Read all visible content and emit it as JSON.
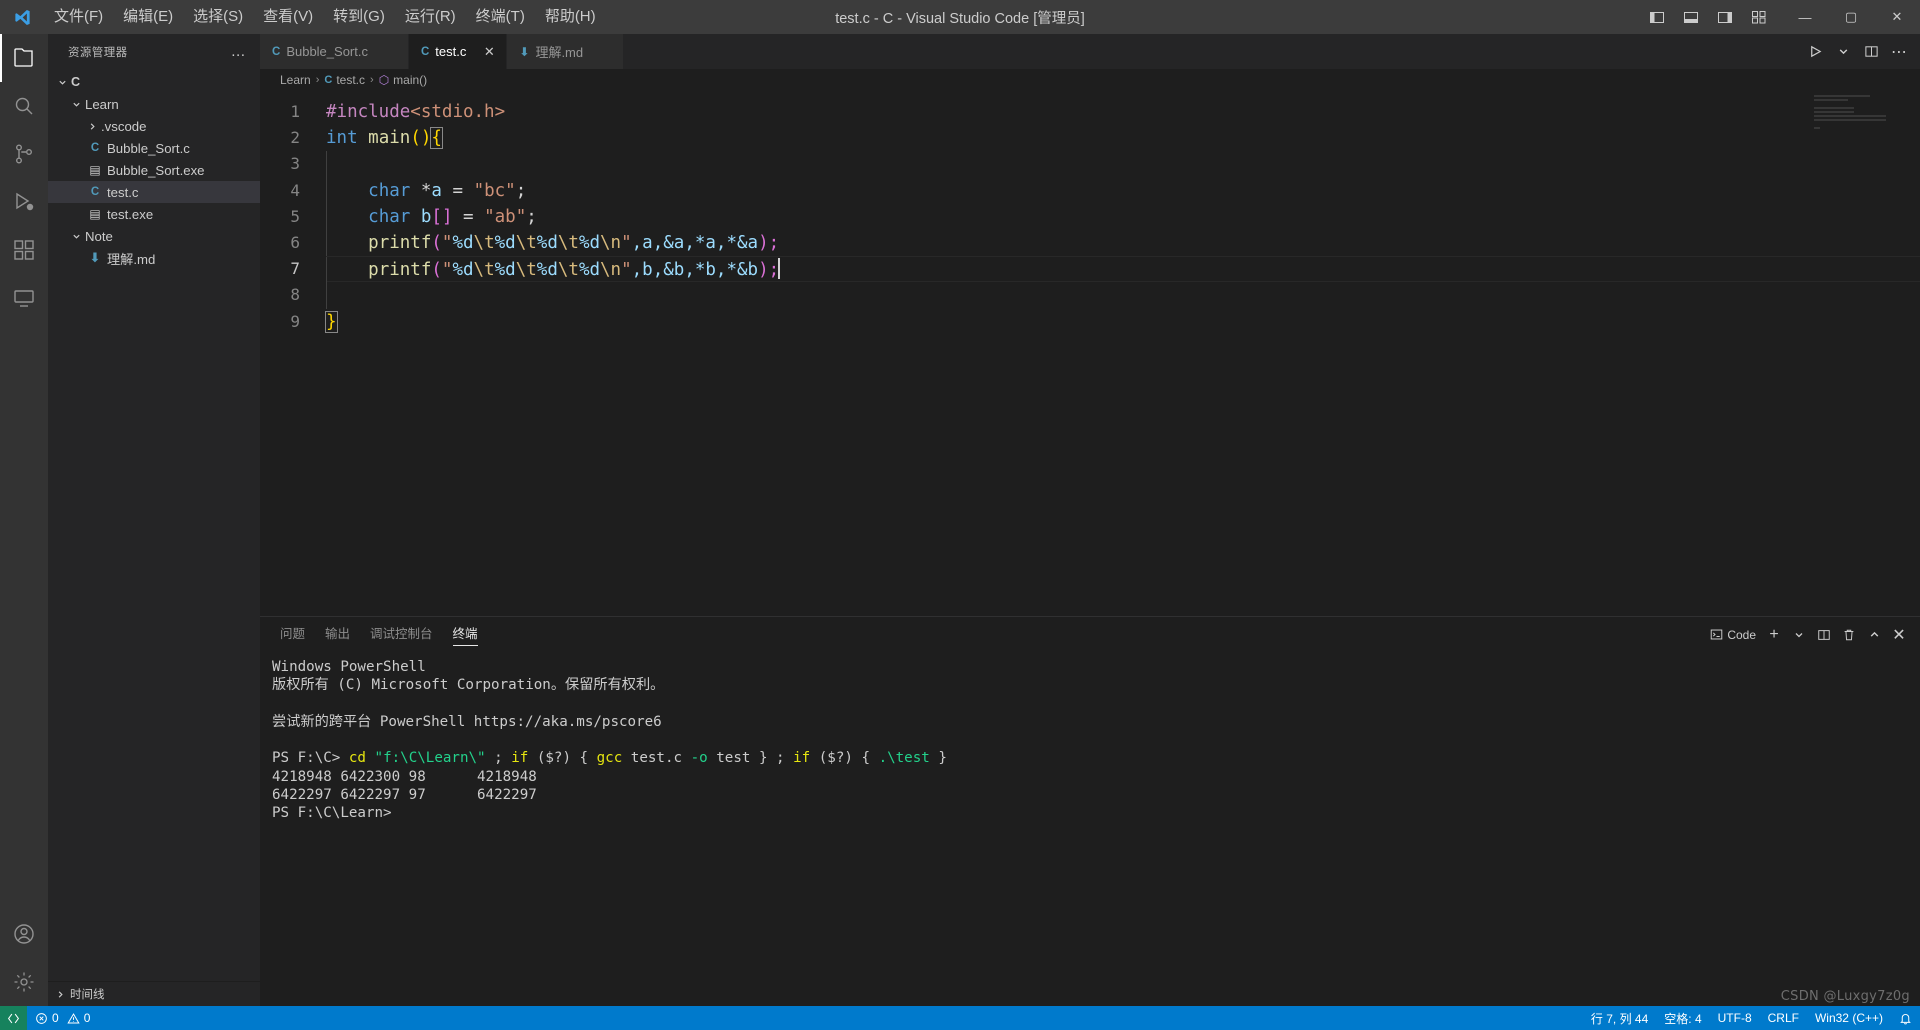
{
  "window": {
    "title": "test.c - C - Visual Studio Code [管理员]",
    "logo_icon": "vscode-logo",
    "minimize_label": "—",
    "maximize_label": "▢",
    "close_label": "✕"
  },
  "menu": {
    "items": [
      {
        "label": "文件(F)",
        "name": "menu-file"
      },
      {
        "label": "编辑(E)",
        "name": "menu-edit"
      },
      {
        "label": "选择(S)",
        "name": "menu-selection"
      },
      {
        "label": "查看(V)",
        "name": "menu-view"
      },
      {
        "label": "转到(G)",
        "name": "menu-goto"
      },
      {
        "label": "运行(R)",
        "name": "menu-run"
      },
      {
        "label": "终端(T)",
        "name": "menu-terminal"
      },
      {
        "label": "帮助(H)",
        "name": "menu-help"
      }
    ]
  },
  "activitybar": {
    "items": [
      {
        "icon": "files-icon",
        "name": "activity-explorer",
        "active": true
      },
      {
        "icon": "search-icon",
        "name": "activity-search",
        "active": false
      },
      {
        "icon": "source-control-icon",
        "name": "activity-source-control",
        "active": false
      },
      {
        "icon": "run-debug-icon",
        "name": "activity-run-debug",
        "active": false
      },
      {
        "icon": "extensions-icon",
        "name": "activity-extensions",
        "active": false
      },
      {
        "icon": "remote-explorer-icon",
        "name": "activity-remote-explorer",
        "active": false
      }
    ],
    "bottom": [
      {
        "icon": "account-icon",
        "name": "activity-account"
      },
      {
        "icon": "gear-icon",
        "name": "activity-settings"
      }
    ]
  },
  "sidebar": {
    "title": "资源管理器",
    "more_actions": "…",
    "tree": [
      {
        "label": "C",
        "indent": 0,
        "twist": "down",
        "icon": "none",
        "bold": true,
        "selected": false
      },
      {
        "label": "Learn",
        "indent": 1,
        "twist": "down",
        "icon": "none",
        "bold": false,
        "selected": false
      },
      {
        "label": ".vscode",
        "indent": 2,
        "twist": "right",
        "icon": "none",
        "bold": false,
        "selected": false
      },
      {
        "label": "Bubble_Sort.c",
        "indent": 2,
        "twist": "none",
        "icon": "c",
        "bold": false,
        "selected": false
      },
      {
        "label": "Bubble_Sort.exe",
        "indent": 2,
        "twist": "none",
        "icon": "exe",
        "bold": false,
        "selected": false
      },
      {
        "label": "test.c",
        "indent": 2,
        "twist": "none",
        "icon": "c",
        "bold": false,
        "selected": true
      },
      {
        "label": "test.exe",
        "indent": 2,
        "twist": "none",
        "icon": "exe",
        "bold": false,
        "selected": false
      },
      {
        "label": "Note",
        "indent": 1,
        "twist": "down",
        "icon": "none",
        "bold": false,
        "selected": false
      },
      {
        "label": "理解.md",
        "indent": 2,
        "twist": "none",
        "icon": "md",
        "bold": false,
        "selected": false
      }
    ],
    "timeline_label": "时间线"
  },
  "tabs": [
    {
      "label": "Bubble_Sort.c",
      "icon": "c",
      "active": false,
      "close": "✕"
    },
    {
      "label": "test.c",
      "icon": "c",
      "active": true,
      "close": "✕"
    },
    {
      "label": "理解.md",
      "icon": "md",
      "active": false,
      "close": "✕"
    }
  ],
  "editor_actions": {
    "run_label": "▷",
    "run_dropdown": "⌄",
    "split_label": "split-editor",
    "more_label": "⋯"
  },
  "breadcrumb": {
    "folder": "Learn",
    "file": "test.c",
    "symbol": "main()",
    "separator": "›"
  },
  "code": {
    "lines": [
      {
        "n": "1",
        "current": false
      },
      {
        "n": "2",
        "current": false
      },
      {
        "n": "3",
        "current": false
      },
      {
        "n": "4",
        "current": false
      },
      {
        "n": "5",
        "current": false
      },
      {
        "n": "6",
        "current": false
      },
      {
        "n": "7",
        "current": true
      },
      {
        "n": "8",
        "current": false
      },
      {
        "n": "9",
        "current": false
      }
    ],
    "text": {
      "l1_include": "#include",
      "l1_header": "<stdio.h>",
      "l2_int": "int",
      "l2_main": "main",
      "l2_parens": "()",
      "l2_brace": "{",
      "l4_char": "char",
      "l4_star": "*",
      "l4_a": "a",
      "l4_eq": " = ",
      "l4_str": "\"bc\"",
      "l4_semi": ";",
      "l5_char": "char",
      "l5_b": "b",
      "l5_brackets": "[]",
      "l5_eq": " = ",
      "l5_str": "\"ab\"",
      "l5_semi": ";",
      "l6_fn": "printf",
      "l6_fmt_q1": "\"",
      "l6_pct": "%d",
      "l6_tab": "\\t",
      "l6_nl": "\\n",
      "l6_args": ",a,&a,*a,*&a",
      "l6_close": ");",
      "l7_fn": "printf",
      "l7_args": ",b,&b,*b,*&b",
      "l7_close": ");",
      "l9_brace": "}"
    }
  },
  "panel": {
    "tabs": [
      {
        "label": "问题",
        "active": false,
        "name": "panel-tab-problems"
      },
      {
        "label": "输出",
        "active": false,
        "name": "panel-tab-output"
      },
      {
        "label": "调试控制台",
        "active": false,
        "name": "panel-tab-debug-console"
      },
      {
        "label": "终端",
        "active": true,
        "name": "panel-tab-terminal"
      }
    ],
    "actions": {
      "shell_label": "Code",
      "new_terminal": "+",
      "dropdown": "⌄",
      "split": "split-terminal",
      "kill": "trash-icon",
      "maximize": "⌃",
      "close": "✕"
    },
    "terminal": {
      "line1": "Windows PowerShell",
      "line2": "版权所有 (C) Microsoft Corporation。保留所有权利。",
      "line3": "",
      "line4": "尝试新的跨平台 PowerShell https://aka.ms/pscore6",
      "line5": "",
      "prompt1": "PS F:\\C>",
      "cmd_cd": "cd",
      "cmd_path": "\"f:\\C\\Learn\\\"",
      "cmd_sep1": " ; ",
      "cmd_if1": "if",
      "cmd_cond1": " ($?) { ",
      "cmd_gcc": "gcc",
      "cmd_gcc_args": " test.c ",
      "cmd_o": "-o",
      "cmd_out": " test } ; ",
      "cmd_if2": "if",
      "cmd_cond2": " ($?) { ",
      "cmd_run": ".\\test",
      "cmd_end": " }",
      "out1": "4218948 6422300 98      4218948",
      "out2": "6422297 6422297 97      6422297",
      "prompt2": "PS F:\\C\\Learn>"
    }
  },
  "statusbar": {
    "remote_icon": "remote-window-icon",
    "errors": "0",
    "warnings": "0",
    "cursor": "行 7, 列 44",
    "indent": "空格: 4",
    "encoding": "UTF-8",
    "eol": "CRLF",
    "language": "Win32 (C++)",
    "bell_icon": "bell-icon"
  },
  "watermark": "CSDN @Luxgy7z0g"
}
